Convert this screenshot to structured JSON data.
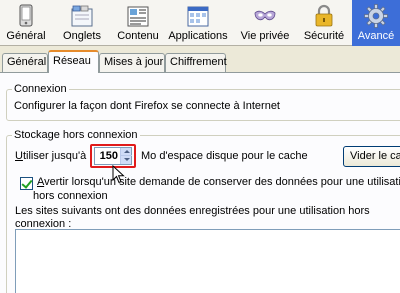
{
  "toolbar": {
    "items": [
      {
        "label": "Général",
        "icon": "general-icon"
      },
      {
        "label": "Onglets",
        "icon": "tabs-icon"
      },
      {
        "label": "Contenu",
        "icon": "content-icon"
      },
      {
        "label": "Applications",
        "icon": "applications-icon"
      },
      {
        "label": "Vie privée",
        "icon": "privacy-mask-icon"
      },
      {
        "label": "Sécurité",
        "icon": "padlock-icon"
      },
      {
        "label": "Avancé",
        "icon": "gear-icon"
      }
    ],
    "active_index": 6,
    "active_color": "#3d6ed8"
  },
  "tabs": {
    "items": [
      {
        "label": "Général"
      },
      {
        "label": "Réseau"
      },
      {
        "label": "Mises à jour"
      },
      {
        "label": "Chiffrement"
      }
    ],
    "active_index": 1,
    "active_accent": "#e68b2c"
  },
  "connexion": {
    "title": "Connexion",
    "description": "Configurer la façon dont Firefox se connecte à Internet"
  },
  "offline": {
    "title": "Stockage hors connexion",
    "use_prefix": "U",
    "use_rest": "tiliser jusqu'à",
    "cache_value": "150",
    "cache_suffix": "Mo d'espace disque pour le cache",
    "clear_button": "Vider le cache",
    "warn_checkbox": {
      "checked": true,
      "prefix": "A",
      "line1": "vertir lorsqu'un site demande de conserver des données pour une utilisation",
      "line2": "hors connexion"
    },
    "sites_label_line1": "Les sites suivants ont des données enregistrées pour une utilisation hors",
    "sites_label_line2": "connexion :",
    "sites": []
  },
  "highlight_color": "#e01b1b"
}
